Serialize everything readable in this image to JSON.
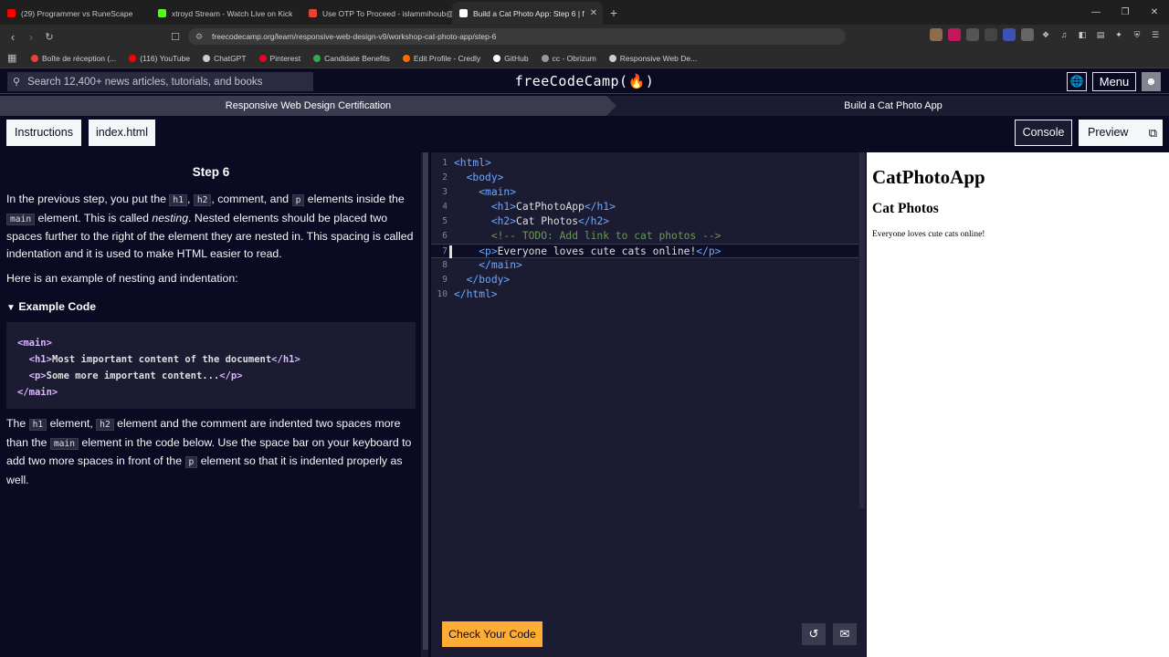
{
  "browser": {
    "tabs": [
      {
        "title": "(29) Programmer vs RuneScape",
        "color": "#ff0000"
      },
      {
        "title": "xtroyd Stream - Watch Live on Kick",
        "color": "#53fc18"
      },
      {
        "title": "Use OTP To Proceed - islammihoub@",
        "color": "#ea4335"
      },
      {
        "title": "Build a Cat Photo App: Step 6 | f",
        "color": "#ffffff"
      }
    ],
    "url": "freecodecamp.org/learn/responsive-web-design-v9/workshop-cat-photo-app/step-6",
    "bookmarks": [
      {
        "label": "Boîte de réception (...",
        "color": "#ea4335"
      },
      {
        "label": "(116) YouTube",
        "color": "#ff0000"
      },
      {
        "label": "ChatGPT",
        "color": "#cccccc"
      },
      {
        "label": "Pinterest",
        "color": "#e60023"
      },
      {
        "label": "Candidate Benefits",
        "color": "#34a853"
      },
      {
        "label": "Edit Profile - Credly",
        "color": "#ff6b00"
      },
      {
        "label": "GitHub",
        "color": "#ffffff"
      },
      {
        "label": "cc - Obrizum",
        "color": "#999999"
      },
      {
        "label": "Responsive Web De...",
        "color": "#cccccc"
      }
    ]
  },
  "fcc": {
    "search_placeholder": "Search 12,400+ news articles, tutorials, and books",
    "logo": "freeCodeCamp(🔥)",
    "menu": "Menu",
    "breadcrumb_left": "Responsive Web Design Certification",
    "breadcrumb_right": "Build a Cat Photo App",
    "tab_instructions": "Instructions",
    "tab_file": "index.html",
    "console": "Console",
    "preview": "Preview"
  },
  "lesson": {
    "step_title": "Step 6",
    "p1": {
      "a": "In the previous step, you put the ",
      "c1": "h1",
      "b": ", ",
      "c2": "h2",
      "c": ", comment, and ",
      "c3": "p",
      "d": " elements inside the ",
      "c4": "main",
      "e": " element. This is called ",
      "em": "nesting",
      "f": ". Nested elements should be placed two spaces further to the right of the element they are nested in. This spacing is called indentation and it is used to make HTML easier to read."
    },
    "p2": "Here is an example of nesting and indentation:",
    "example_label": "Example Code",
    "example_lines": [
      {
        "pre": "",
        "open": "<main>",
        "text": "",
        "close": ""
      },
      {
        "pre": "  ",
        "open": "<h1>",
        "text": "Most important content of the document",
        "close": "</h1>"
      },
      {
        "pre": "  ",
        "open": "<p>",
        "text": "Some more important content...",
        "close": "</p>"
      },
      {
        "pre": "",
        "open": "</main>",
        "text": "",
        "close": ""
      }
    ],
    "p3": {
      "a": "The ",
      "c1": "h1",
      "b": " element, ",
      "c2": "h2",
      "c": " element and the comment are indented two spaces more than the ",
      "c3": "main",
      "d": " element in the code below. Use the space bar on your keyboard to add two more spaces in front of the ",
      "c4": "p",
      "e": " element so that it is indented properly as well."
    }
  },
  "editor": {
    "lines": [
      {
        "n": "1",
        "indent": "",
        "open": "<html>",
        "text": "",
        "close": ""
      },
      {
        "n": "2",
        "indent": "  ",
        "open": "<body>",
        "text": "",
        "close": ""
      },
      {
        "n": "3",
        "indent": "    ",
        "open": "<main>",
        "text": "",
        "close": ""
      },
      {
        "n": "4",
        "indent": "      ",
        "open": "<h1>",
        "text": "CatPhotoApp",
        "close": "</h1>"
      },
      {
        "n": "5",
        "indent": "      ",
        "open": "<h2>",
        "text": "Cat Photos",
        "close": "</h2>"
      },
      {
        "n": "6",
        "indent": "      ",
        "comment": "<!-- TODO: Add link to cat photos -->"
      },
      {
        "n": "7",
        "indent": "    ",
        "open": "<p>",
        "text": "Everyone loves cute cats online!",
        "close": "</p>"
      },
      {
        "n": "8",
        "indent": "    ",
        "open": "</main>",
        "text": "",
        "close": ""
      },
      {
        "n": "9",
        "indent": "  ",
        "open": "</body>",
        "text": "",
        "close": ""
      },
      {
        "n": "10",
        "indent": "",
        "open": "</html>",
        "text": "",
        "close": ""
      }
    ],
    "check_button": "Check Your Code"
  },
  "preview_pane": {
    "h1": "CatPhotoApp",
    "h2": "Cat Photos",
    "p": "Everyone loves cute cats online!"
  }
}
